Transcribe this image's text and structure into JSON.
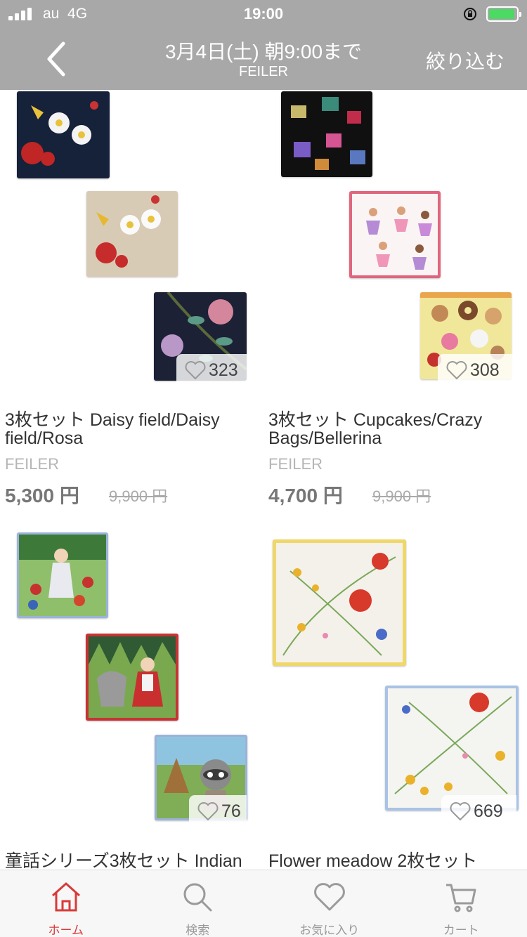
{
  "status_bar": {
    "carrier": "au",
    "network": "4G",
    "time": "19:00"
  },
  "nav": {
    "title": "3月4日(土) 朝9:00まで",
    "subtitle": "FEILER",
    "filter_label": "絞り込む"
  },
  "products": [
    {
      "title": "3枚セット Daisy field/Daisy field/Rosa",
      "brand": "FEILER",
      "price": "5,300 円",
      "original_price": "9,900 円",
      "likes": "323"
    },
    {
      "title": "3枚セット Cupcakes/Crazy Bags/Bellerina",
      "brand": "FEILER",
      "price": "4,700 円",
      "original_price": "9,900 円",
      "likes": "308"
    },
    {
      "title": "童話シリーズ3枚セット Indian",
      "brand": "",
      "price": "",
      "original_price": "",
      "likes": "76"
    },
    {
      "title": "Flower meadow 2枚セット",
      "brand": "",
      "price": "",
      "original_price": "",
      "likes": "669"
    }
  ],
  "tabs": [
    {
      "label": "ホーム",
      "icon": "home-icon",
      "active": true
    },
    {
      "label": "検索",
      "icon": "search-icon",
      "active": false
    },
    {
      "label": "お気に入り",
      "icon": "heart-icon",
      "active": false
    },
    {
      "label": "カート",
      "icon": "cart-icon",
      "active": false
    }
  ],
  "colors": {
    "nav_bg": "#a8a8a8",
    "active_tab": "#d93a3a",
    "battery": "#4cd964"
  }
}
